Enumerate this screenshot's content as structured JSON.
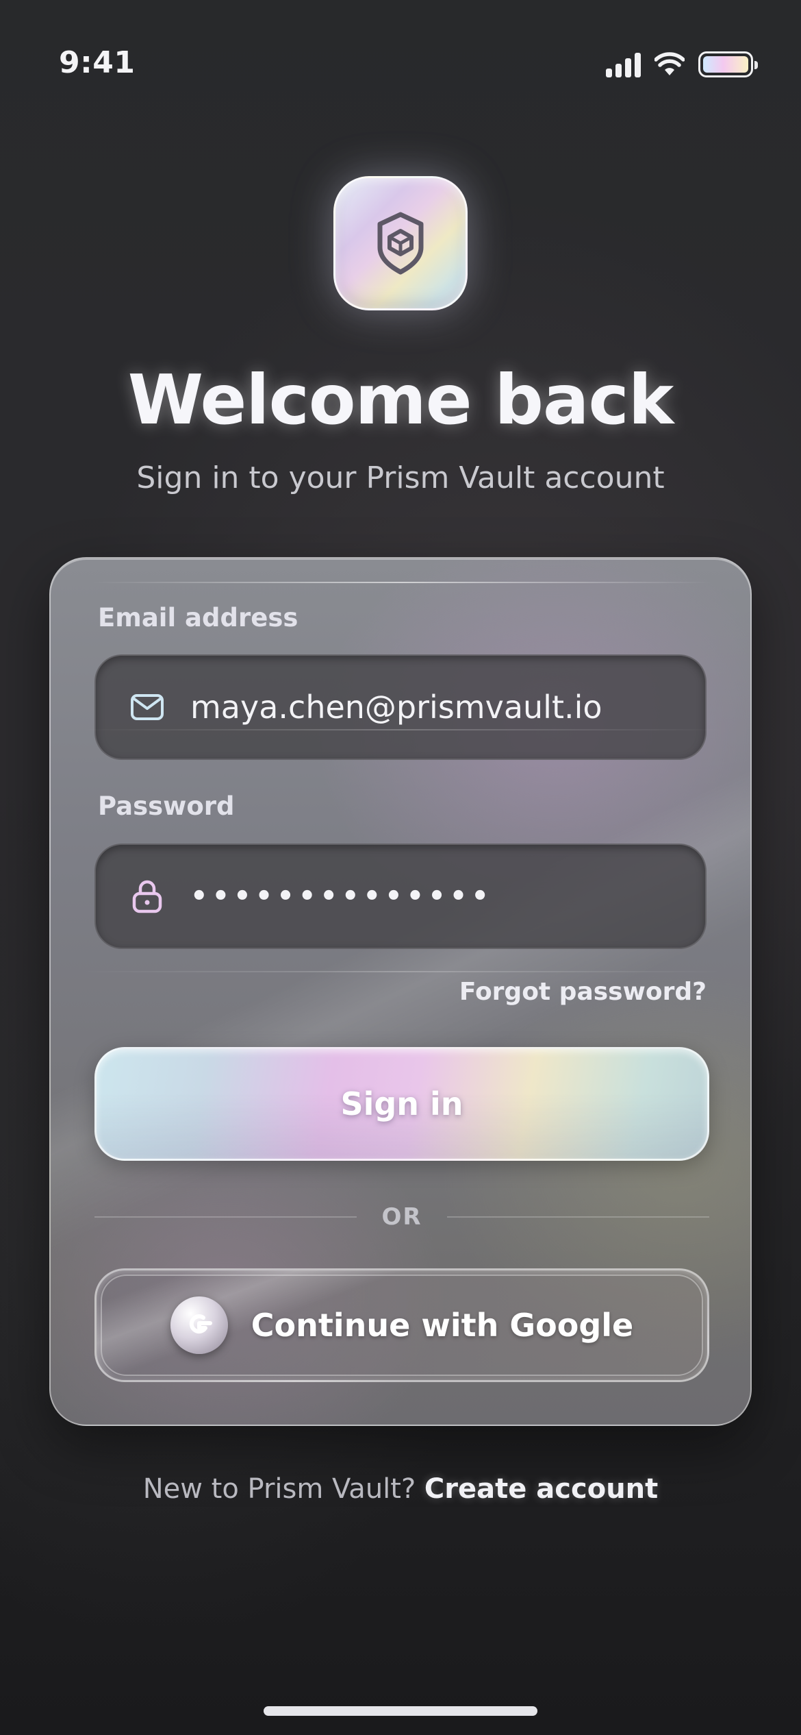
{
  "status_bar": {
    "time": "9:41",
    "icons": [
      "cellular-signal-icon",
      "wifi-icon",
      "battery-icon"
    ]
  },
  "app_icon": {
    "icon": "shield-cube-icon"
  },
  "header": {
    "title": "Welcome back",
    "subtitle": "Sign in to your Prism Vault account"
  },
  "form": {
    "email": {
      "label": "Email address",
      "value": "maya.chen@prismvault.io",
      "icon": "mail-icon"
    },
    "password": {
      "label": "Password",
      "value": "••••••••••••••",
      "icon": "lock-icon"
    },
    "forgot_link": "Forgot password?",
    "sign_in_label": "Sign in",
    "divider_text": "OR",
    "google_label": "Continue with Google",
    "google_icon": "google-icon"
  },
  "footer": {
    "prompt": "New to Prism Vault?",
    "link": "Create account"
  },
  "colors": {
    "background": "#28292b",
    "card": "#7d7e86",
    "input": "#444246",
    "text_primary": "#f3f3f6",
    "text_secondary": "#c9c9cf"
  }
}
